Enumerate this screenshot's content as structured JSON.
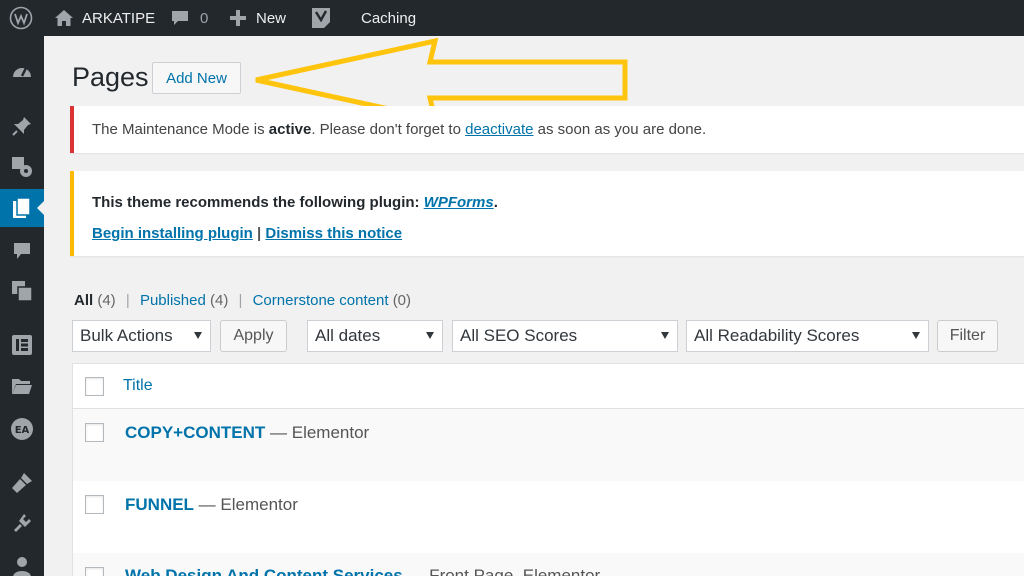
{
  "admin_bar": {
    "site_name": "ARKATIPE",
    "comments_count": "0",
    "new_label": "New",
    "caching_label": "Caching",
    "icons": [
      "wordpress-logo-icon",
      "home-icon",
      "comment-bubble-icon",
      "plus-icon",
      "yoast-icon"
    ]
  },
  "sidebar": {
    "icons": [
      "dashboard-icon",
      "pin-icon",
      "media-icon",
      "pages-icon",
      "comments-icon",
      "feedback-icon",
      "elementor-icon",
      "folder-icon",
      "ea-icon",
      "appearance-icon",
      "plugins-icon",
      "users-icon"
    ],
    "current": "pages-icon"
  },
  "page": {
    "title": "Pages",
    "add_new": "Add New"
  },
  "notice_maintenance": {
    "text_before": "The Maintenance Mode is ",
    "active": "active",
    "text_middle": ". Please don't forget to ",
    "link": "deactivate",
    "text_after": " as soon as you are done."
  },
  "notice_plugin": {
    "text": "This theme recommends the following plugin: ",
    "plugin": "WPForms",
    "period": ".",
    "install_link": "Begin installing plugin",
    "separator": " | ",
    "dismiss_link": "Dismiss this notice"
  },
  "views": {
    "all_label": "All",
    "all_count": "(4)",
    "published_label": "Published",
    "published_count": "(4)",
    "cornerstone_label": "Cornerstone content",
    "cornerstone_count": "(0)",
    "separator": "|"
  },
  "filters": {
    "bulk_actions": "Bulk Actions",
    "apply": "Apply",
    "dates": "All dates",
    "seo": "All SEO Scores",
    "readability": "All Readability Scores",
    "filter": "Filter"
  },
  "table": {
    "header_title": "Title",
    "rows": [
      {
        "title": "COPY+CONTENT",
        "state": " — Elementor"
      },
      {
        "title": "FUNNEL",
        "state": " — Elementor"
      },
      {
        "title": "Web Design And Content Services",
        "state": " — Front Page, Elementor"
      }
    ]
  },
  "colors": {
    "adminbar": "#23282d",
    "accent": "#0073aa",
    "error": "#dc3232",
    "warning": "#ffb900",
    "annotation_arrow": "#ffc40d"
  }
}
